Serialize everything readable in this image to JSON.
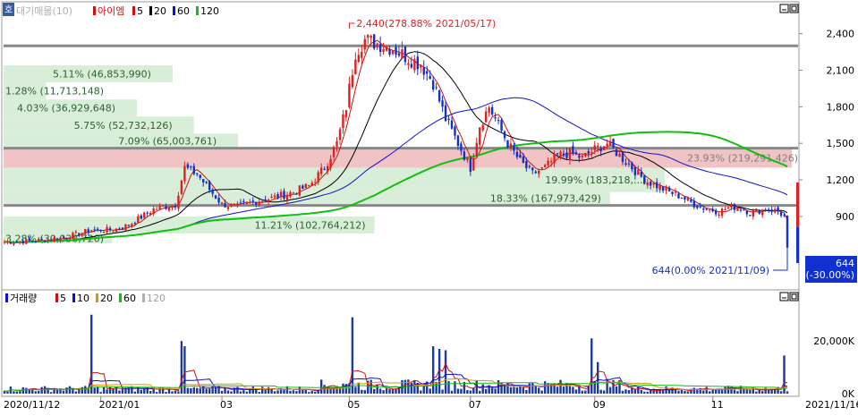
{
  "chart_data": [
    {
      "type": "candlestick",
      "legend": {
        "prefix": "호",
        "title": "대기매물(10)",
        "ticker": "아이엠",
        "ma_items": [
          {
            "label": "5",
            "color": "#d01010"
          },
          {
            "label": "20",
            "color": "#000000"
          },
          {
            "label": "60",
            "color": "#1010d0"
          },
          {
            "label": "120",
            "color": "#10c010"
          }
        ]
      },
      "x_ticks": [
        {
          "label": "2020/11/12",
          "bar": 0
        },
        {
          "label": "2021/01",
          "bar": 31
        },
        {
          "label": "03",
          "bar": 70
        },
        {
          "label": "05",
          "bar": 111
        },
        {
          "label": "07",
          "bar": 150
        },
        {
          "label": "09",
          "bar": 190
        },
        {
          "label": "11",
          "bar": 228
        },
        {
          "label": "2021/11/16",
          "bar": 246
        }
      ],
      "y_ticks": [
        {
          "label": "2,400",
          "value": 2400
        },
        {
          "label": "2,100",
          "value": 2100
        },
        {
          "label": "1,800",
          "value": 1800
        },
        {
          "label": "1,500",
          "value": 1500
        },
        {
          "label": "1,200",
          "value": 1200
        },
        {
          "label": "900",
          "value": 900
        }
      ],
      "ylim": [
        400,
        2500
      ],
      "volume_profile": [
        {
          "label": "3.28% (30,038,720)",
          "pct": 3.28,
          "volume": 30038720,
          "from": 680,
          "to": 760
        },
        {
          "label": "11.21% (102,764,212)",
          "pct": 11.21,
          "volume": 102764212,
          "from": 760,
          "to": 900
        },
        {
          "label": "18.33% (167,973,429)",
          "pct": 18.33,
          "volume": 167973429,
          "from": 1000,
          "to": 1100
        },
        {
          "label": "19.99% (183,218,...)",
          "pct": 19.99,
          "volume": 183218000,
          "from": 1100,
          "to": 1300
        },
        {
          "label": "23.93% (219,291,426)",
          "pct": 23.93,
          "volume": 219291426,
          "from": 1300,
          "to": 1460,
          "highlight": true
        },
        {
          "label": "7.09% (65,003,761)",
          "pct": 7.09,
          "volume": 65003761,
          "from": 1460,
          "to": 1580
        },
        {
          "label": "5.75% (52,732,126)",
          "pct": 5.75,
          "volume": 52732126,
          "from": 1580,
          "to": 1720
        },
        {
          "label": "4.03% (36,929,648)",
          "pct": 4.03,
          "volume": 36929648,
          "from": 1720,
          "to": 1860
        },
        {
          "label": "1.28% (11,713,148)",
          "pct": 1.28,
          "volume": 11713148,
          "from": 1860,
          "to": 2000
        },
        {
          "label": "5.11% (46,853,990)",
          "pct": 5.11,
          "volume": 46853990,
          "from": 2000,
          "to": 2140
        }
      ],
      "gray_levels": [
        2300,
        1460,
        990
      ],
      "high_annotation": "2,440(278.88% 2021/05/17)",
      "low_annotation": "644(0.00% 2021/11/09)",
      "current_price": {
        "label": "644",
        "change": "(-30.00%)"
      },
      "price_path": [
        [
          0,
          690
        ],
        [
          10,
          700
        ],
        [
          20,
          730
        ],
        [
          28,
          790
        ],
        [
          35,
          790
        ],
        [
          40,
          830
        ],
        [
          48,
          960
        ],
        [
          55,
          1000
        ],
        [
          58,
          1300
        ],
        [
          62,
          1250
        ],
        [
          65,
          1150
        ],
        [
          70,
          1000
        ],
        [
          75,
          980
        ],
        [
          80,
          1020
        ],
        [
          86,
          1050
        ],
        [
          93,
          1100
        ],
        [
          98,
          1150
        ],
        [
          103,
          1300
        ],
        [
          107,
          1500
        ],
        [
          110,
          1800
        ],
        [
          113,
          2250
        ],
        [
          116,
          2350
        ],
        [
          120,
          2320
        ],
        [
          125,
          2280
        ],
        [
          130,
          2200
        ],
        [
          134,
          2150
        ],
        [
          138,
          2000
        ],
        [
          142,
          1700
        ],
        [
          146,
          1500
        ],
        [
          150,
          1300
        ],
        [
          153,
          1650
        ],
        [
          156,
          1800
        ],
        [
          158,
          1700
        ],
        [
          162,
          1500
        ],
        [
          166,
          1350
        ],
        [
          170,
          1250
        ],
        [
          174,
          1300
        ],
        [
          178,
          1400
        ],
        [
          182,
          1420
        ],
        [
          186,
          1380
        ],
        [
          190,
          1450
        ],
        [
          194,
          1500
        ],
        [
          198,
          1400
        ],
        [
          202,
          1300
        ],
        [
          206,
          1200
        ],
        [
          210,
          1150
        ],
        [
          214,
          1100
        ],
        [
          218,
          1060
        ],
        [
          222,
          1000
        ],
        [
          226,
          960
        ],
        [
          230,
          940
        ],
        [
          234,
          980
        ],
        [
          238,
          960
        ],
        [
          240,
          930
        ],
        [
          243,
          950
        ],
        [
          246,
          960
        ],
        [
          249,
          940
        ],
        [
          251,
          900
        ],
        [
          252,
          644
        ]
      ],
      "candle_count": 253
    },
    {
      "type": "bar",
      "legend": {
        "title": "거래량",
        "ma_items": [
          {
            "label": "5",
            "color": "#d01010"
          },
          {
            "label": "10",
            "color": "#1010d0"
          },
          {
            "label": "20",
            "color": "#e09010"
          },
          {
            "label": "60",
            "color": "#10c010"
          },
          {
            "label": "120",
            "color": "#b0b0b0"
          }
        ]
      },
      "y_ticks": [
        {
          "label": "20,000K",
          "value": 20000
        },
        {
          "label": "0K",
          "value": 0
        }
      ],
      "ylim": [
        0,
        34000
      ],
      "spikes": [
        {
          "bar": 28,
          "value": 30000
        },
        {
          "bar": 57,
          "value": 20000
        },
        {
          "bar": 58,
          "value": 18000
        },
        {
          "bar": 112,
          "value": 29000
        },
        {
          "bar": 138,
          "value": 18000
        },
        {
          "bar": 140,
          "value": 17000
        },
        {
          "bar": 142,
          "value": 16500
        },
        {
          "bar": 189,
          "value": 21000
        },
        {
          "bar": 191,
          "value": 12000
        },
        {
          "bar": 251,
          "value": 14500
        }
      ],
      "base_volume": 1500
    }
  ]
}
